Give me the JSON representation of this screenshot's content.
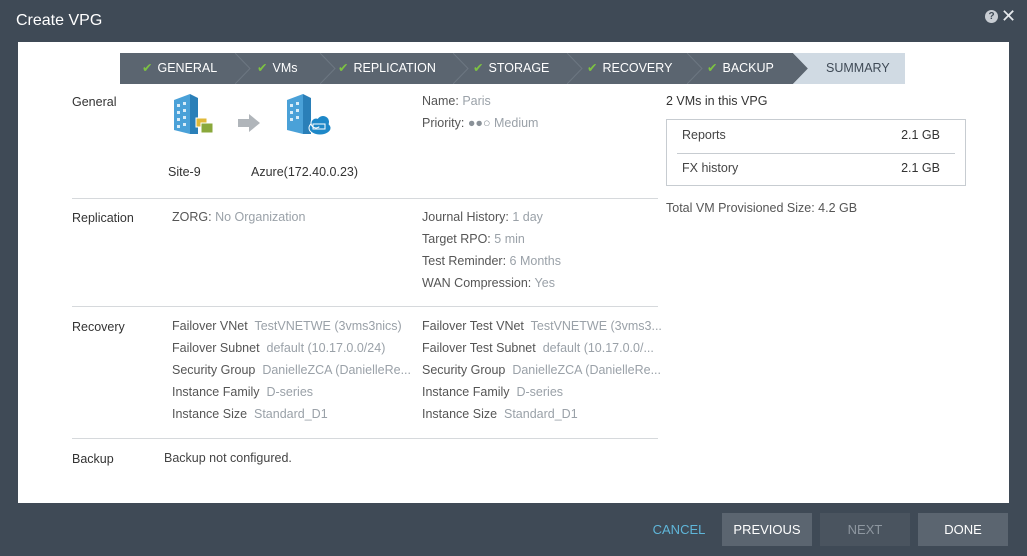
{
  "window": {
    "title": "Create VPG"
  },
  "wizard": {
    "steps": [
      {
        "label": "GENERAL",
        "check": "✔"
      },
      {
        "label": "VMs",
        "check": "✔"
      },
      {
        "label": "REPLICATION",
        "check": "✔"
      },
      {
        "label": "STORAGE",
        "check": "✔"
      },
      {
        "label": "RECOVERY",
        "check": "✔"
      },
      {
        "label": "BACKUP",
        "check": "✔"
      },
      {
        "label": "SUMMARY",
        "check": ""
      }
    ]
  },
  "general": {
    "label": "General",
    "source_site": "Site-9",
    "target_site": "Azure(172.40.0.23)",
    "name_key": "Name:",
    "name_val": "Paris",
    "priority_key": "Priority:",
    "priority_dots": "●●○",
    "priority_val": "Medium"
  },
  "vms": {
    "header": "2 VMs in this VPG",
    "items": [
      {
        "name": "Reports",
        "size": "2.1 GB"
      },
      {
        "name": "FX history",
        "size": "2.1 GB"
      }
    ],
    "total_key": "Total VM Provisioned Size:",
    "total_val": "4.2 GB"
  },
  "replication": {
    "label": "Replication",
    "zorg_key": "ZORG:",
    "zorg_val": "No Organization",
    "journal_key": "Journal History:",
    "journal_val": "1 day",
    "rpo_key": "Target RPO:",
    "rpo_val": "5 min",
    "reminder_key": "Test Reminder:",
    "reminder_val": "6 Months",
    "wan_key": "WAN Compression:",
    "wan_val": "Yes"
  },
  "recovery": {
    "label": "Recovery",
    "left": [
      {
        "key": "Failover VNet",
        "val": "TestVNETWE (3vms3nics)"
      },
      {
        "key": "Failover Subnet",
        "val": "default (10.17.0.0/24)"
      },
      {
        "key": "Security Group",
        "val": "DanielleZCA (DanielleRe..."
      },
      {
        "key": "Instance Family",
        "val": "D-series"
      },
      {
        "key": "Instance Size",
        "val": "Standard_D1"
      }
    ],
    "right": [
      {
        "key": "Failover Test VNet",
        "val": "TestVNETWE (3vms3..."
      },
      {
        "key": "Failover Test Subnet",
        "val": "default (10.17.0.0/..."
      },
      {
        "key": "Security Group",
        "val": "DanielleZCA (DanielleRe..."
      },
      {
        "key": "Instance Family",
        "val": "D-series"
      },
      {
        "key": "Instance Size",
        "val": "Standard_D1"
      }
    ]
  },
  "backup": {
    "label": "Backup",
    "value": "Backup not configured."
  },
  "footer": {
    "cancel": "CANCEL",
    "previous": "PREVIOUS",
    "next": "NEXT",
    "done": "DONE"
  },
  "colors": {
    "chrome": "#3f4a56",
    "step_done": "#5b6570",
    "step_current": "#d0dae3",
    "check": "#7dc242",
    "link": "#5fb6d9"
  }
}
